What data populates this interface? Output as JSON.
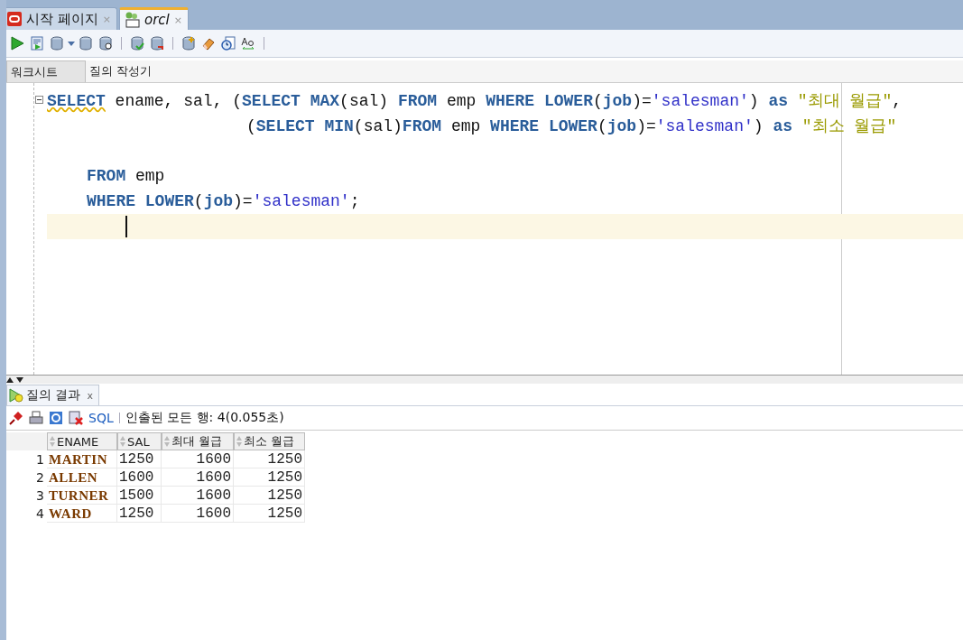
{
  "doc_tabs": [
    {
      "label": "시작 페이지",
      "kind": "start",
      "selected": false,
      "close": "×"
    },
    {
      "label": "orcl",
      "kind": "sql",
      "selected": true,
      "close": "×"
    }
  ],
  "editor_tabs": [
    {
      "label": "워크시트",
      "selected": true
    },
    {
      "label": "질의 작성기",
      "selected": false
    }
  ],
  "code_lines": [
    {
      "kind": "first",
      "tokens": [
        {
          "t": "SELECT",
          "kind": "kw"
        },
        {
          "t": " ename, sal, (",
          "kind": "id"
        },
        {
          "t": "SELECT MAX",
          "kind": "kw"
        },
        {
          "t": "(sal) ",
          "kind": "id"
        },
        {
          "t": "FROM",
          "kind": "kw"
        },
        {
          "t": " emp ",
          "kind": "id"
        },
        {
          "t": "WHERE LOWER",
          "kind": "kw"
        },
        {
          "t": "(",
          "kind": "id"
        },
        {
          "t": "job",
          "kind": "kw"
        },
        {
          "t": ")=",
          "kind": "id"
        },
        {
          "t": "'salesman'",
          "kind": "str"
        },
        {
          "t": ") ",
          "kind": "id"
        },
        {
          "t": "as ",
          "kind": "kw"
        },
        {
          "t": "\"최대 월급\"",
          "kind": "alias"
        },
        {
          "t": ",",
          "kind": "id"
        }
      ]
    },
    {
      "kind": "continuation",
      "tokens": [
        {
          "t": "(",
          "kind": "id"
        },
        {
          "t": "SELECT MIN",
          "kind": "kw"
        },
        {
          "t": "(sal)",
          "kind": "id"
        },
        {
          "t": "FROM",
          "kind": "kw"
        },
        {
          "t": " emp ",
          "kind": "id"
        },
        {
          "t": "WHERE LOWER",
          "kind": "kw"
        },
        {
          "t": "(",
          "kind": "id"
        },
        {
          "t": "job",
          "kind": "kw"
        },
        {
          "t": ")=",
          "kind": "id"
        },
        {
          "t": "'salesman'",
          "kind": "str"
        },
        {
          "t": ") ",
          "kind": "id"
        },
        {
          "t": "as ",
          "kind": "kw"
        },
        {
          "t": "\"최소 월급\"",
          "kind": "alias"
        }
      ]
    },
    {
      "kind": "blank"
    },
    {
      "kind": "clause",
      "tokens": [
        {
          "t": "FROM",
          "kind": "kw"
        },
        {
          "t": " emp",
          "kind": "id"
        }
      ]
    },
    {
      "kind": "clause",
      "tokens": [
        {
          "t": "WHERE LOWER",
          "kind": "kw"
        },
        {
          "t": "(",
          "kind": "id"
        },
        {
          "t": "job",
          "kind": "kw"
        },
        {
          "t": ")=",
          "kind": "id"
        },
        {
          "t": "'salesman'",
          "kind": "str"
        },
        {
          "t": ";",
          "kind": "id"
        }
      ]
    },
    {
      "kind": "cursor"
    }
  ],
  "results_tab": {
    "label": "질의 결과",
    "close": "x"
  },
  "results_toolbar": {
    "sql_link": "SQL",
    "status": "인출된 모든 행: 4(0.055초)"
  },
  "table": {
    "columns": [
      {
        "label": "ENAME",
        "kind": "name"
      },
      {
        "label": "SAL",
        "kind": "plain"
      },
      {
        "label": "최대 월급",
        "kind": "aggregate"
      },
      {
        "label": "최소 월급",
        "kind": "aggregate"
      }
    ],
    "rows": [
      {
        "num": "1",
        "cells": [
          "MARTIN",
          "1250",
          "1600",
          "1250"
        ]
      },
      {
        "num": "2",
        "cells": [
          "ALLEN",
          "1600",
          "1600",
          "1250"
        ]
      },
      {
        "num": "3",
        "cells": [
          "TURNER",
          "1500",
          "1600",
          "1250"
        ]
      },
      {
        "num": "4",
        "cells": [
          "WARD",
          "1250",
          "1600",
          "1250"
        ]
      }
    ]
  }
}
